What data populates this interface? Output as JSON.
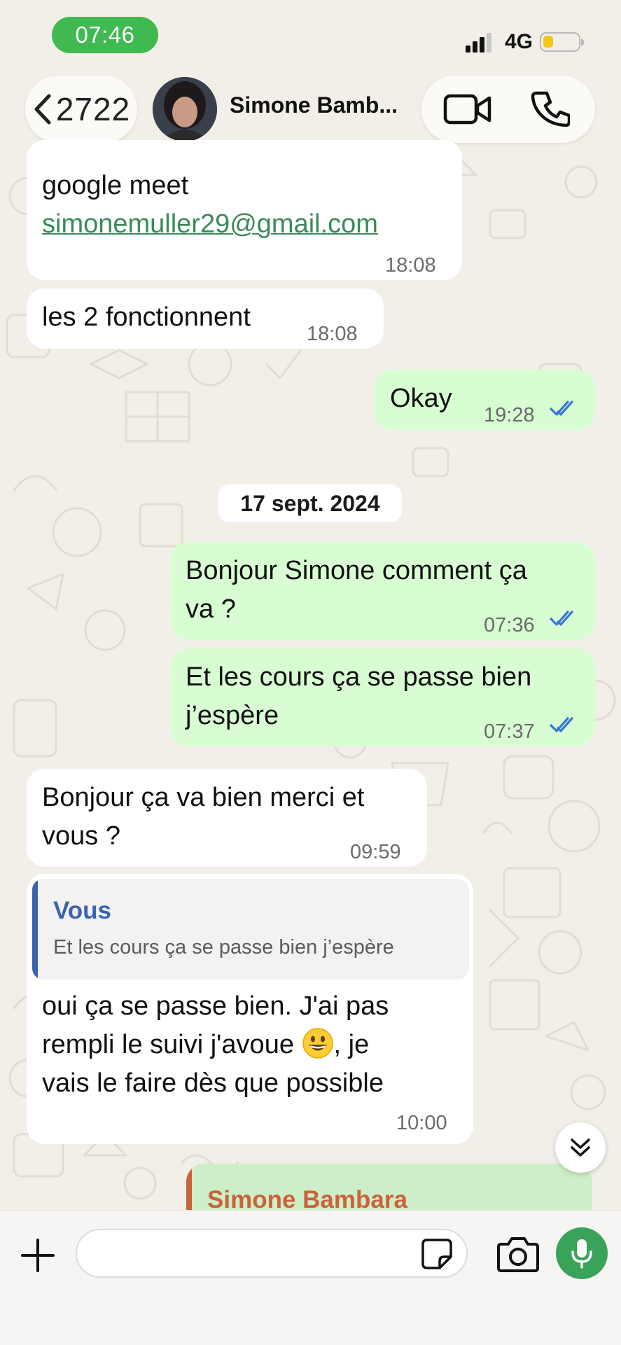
{
  "status_bar": {
    "time": "07:46",
    "network": "4G",
    "battery_level": 0.3,
    "icons": [
      "signal-icon",
      "battery-icon"
    ]
  },
  "header": {
    "back_count": "2722",
    "contact_name": "Simone Bamb...",
    "icons": [
      "chevron-left-icon",
      "video-call-icon",
      "phone-icon"
    ]
  },
  "messages": [
    {
      "direction": "in",
      "text_line": "google meet",
      "link": "simonemuller29@gmail.com",
      "time": "18:08"
    },
    {
      "direction": "in",
      "text": "les 2 fonctionnent",
      "time": "18:08"
    },
    {
      "direction": "out",
      "text": "Okay",
      "time": "19:28",
      "read": true
    },
    {
      "direction": "out",
      "lines": [
        "Bonjour Simone comment ça",
        "va ?"
      ],
      "time": "07:36",
      "read": true
    },
    {
      "direction": "out",
      "lines": [
        "Et les cours ça se passe bien",
        "j’espère"
      ],
      "time": "07:37",
      "read": true
    },
    {
      "direction": "in",
      "lines": [
        "Bonjour ça va bien merci et",
        "vous ?"
      ],
      "time": "09:59"
    },
    {
      "direction": "in",
      "quote": {
        "author": "Vous",
        "text": "Et les cours ça se passe bien j’espère"
      },
      "line1": "oui ça se passe bien. J'ai pas",
      "line2_before": "rempli le suivi j'avoue ",
      "line2_after": ", je",
      "line3": "vais le faire dès que possible",
      "emoji": "grinning-face-emoji",
      "time": "10:00"
    }
  ],
  "date_separator": "17 sept. 2024",
  "partial_reply": {
    "quote_author": "Simone Bambara"
  },
  "input_bar": {
    "placeholder": "",
    "icons": [
      "plus-icon",
      "sticker-icon",
      "camera-icon",
      "microphone-icon"
    ]
  },
  "colors": {
    "status_pill": "#3fb950",
    "outgoing_bubble": "#d9fdd3",
    "incoming_bubble": "#ffffff",
    "link": "#3b8a5a",
    "read_ticks": "#3478d8",
    "quote_you": "#3c63b0",
    "quote_contact": "#c8633c",
    "mic_button": "#3aa35a",
    "wallpaper": "#f2efe9"
  }
}
